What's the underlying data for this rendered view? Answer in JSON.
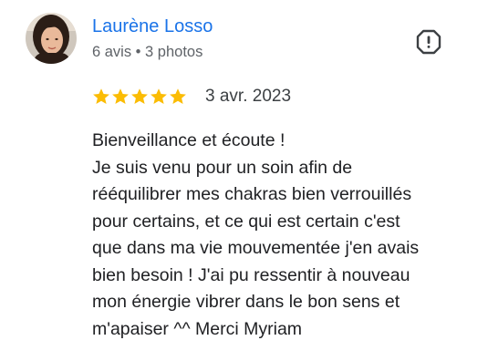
{
  "review": {
    "author_name": "Laurène Losso",
    "author_meta": "6 avis • 3 photos",
    "rating": 5,
    "rating_max": 5,
    "date": "3 avr. 2023",
    "text_lines": [
      "Bienveillance et écoute !",
      "Je suis venu pour un soin afin de",
      "rééquilibrer mes chakras bien verrouillés",
      "pour certains, et ce qui est certain c'est",
      "que dans ma vie mouvementée j'en avais",
      "bien besoin ! J'ai pu ressentir à nouveau",
      "mon énergie vibrer dans le bon sens et",
      "m'apaiser ^^ Merci Myriam"
    ]
  },
  "icons": {
    "avatar": "user-photo",
    "report": "report-flag-icon",
    "star": "star-icon"
  },
  "colors": {
    "author_name": "#1a73e8",
    "meta_text": "#5f6368",
    "star": "#fbbc04",
    "body_text": "#202124",
    "icon": "#3c4043"
  }
}
